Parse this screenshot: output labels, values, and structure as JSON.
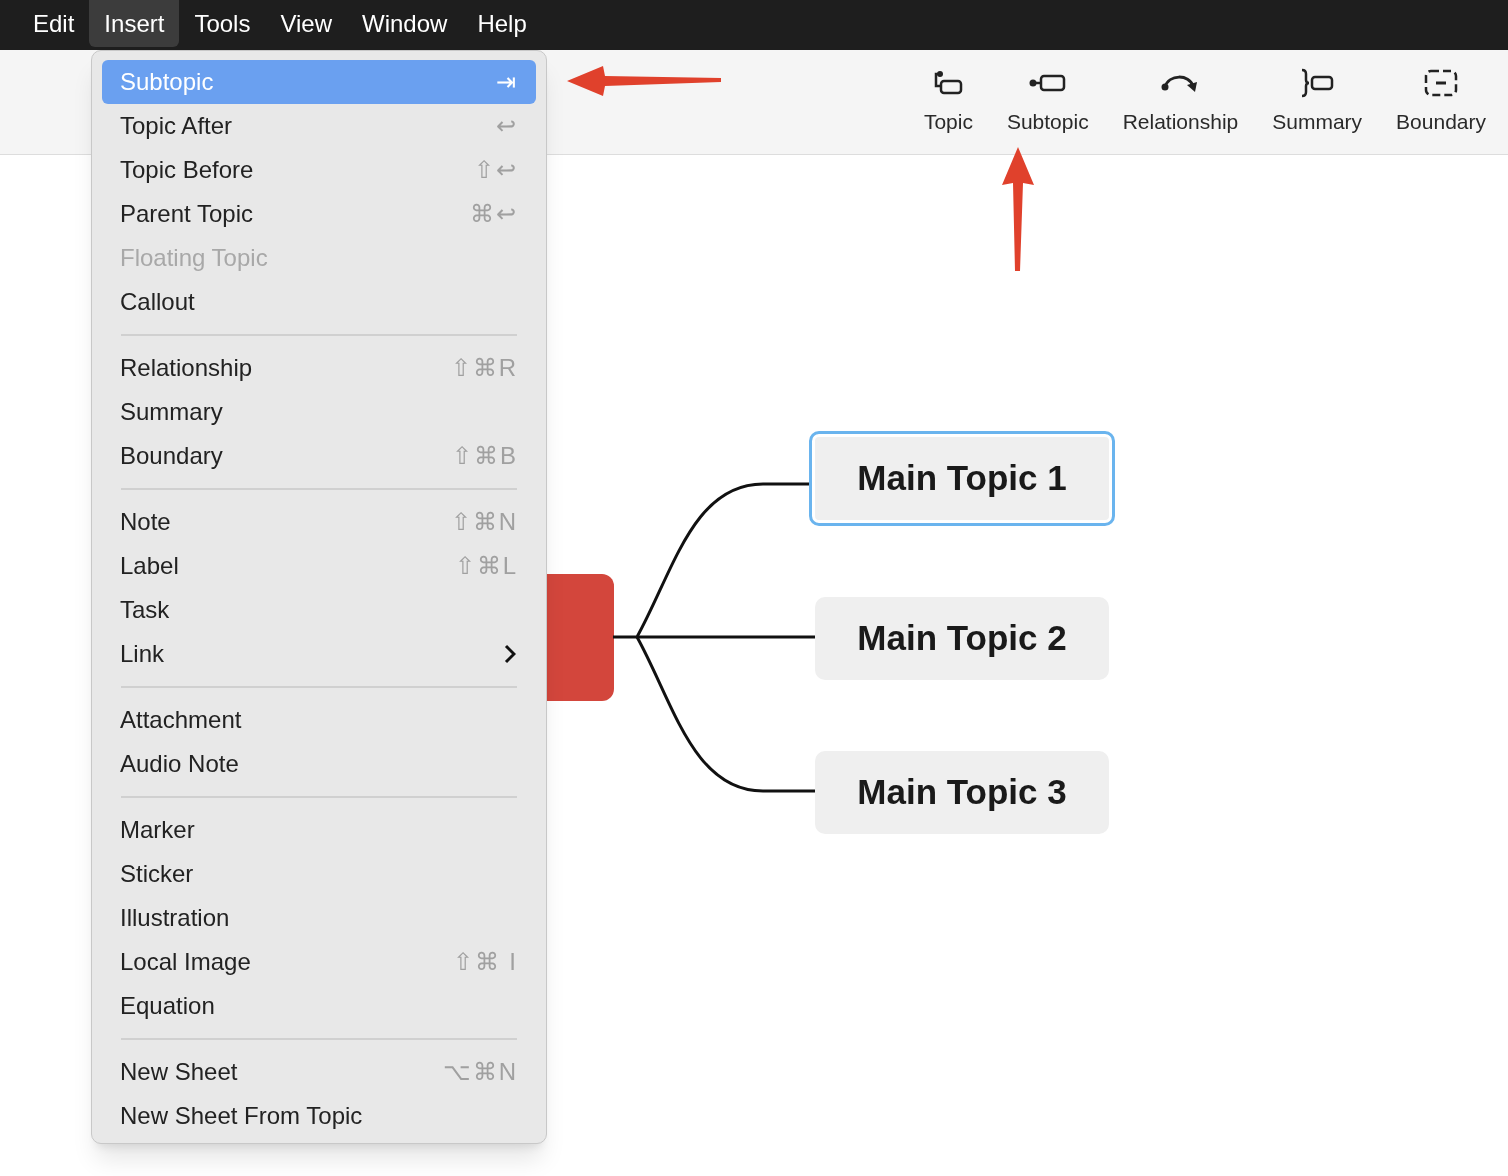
{
  "menu_bar": {
    "items": [
      {
        "label": "Edit",
        "selected": false
      },
      {
        "label": "Insert",
        "selected": true
      },
      {
        "label": "Tools",
        "selected": false
      },
      {
        "label": "View",
        "selected": false
      },
      {
        "label": "Window",
        "selected": false
      },
      {
        "label": "Help",
        "selected": false
      }
    ]
  },
  "toolbar": {
    "buttons": [
      {
        "label": "Topic",
        "kind": "topic"
      },
      {
        "label": "Subtopic",
        "kind": "subtopic"
      },
      {
        "label": "Relationship",
        "kind": "relationship"
      },
      {
        "label": "Summary",
        "kind": "summary"
      },
      {
        "label": "Boundary",
        "kind": "boundary"
      }
    ]
  },
  "insert_menu": {
    "groups": [
      {
        "items": [
          {
            "label": "Subtopic",
            "shortcut": "⇥",
            "selected": true,
            "disabled": false,
            "kind": "command"
          },
          {
            "label": "Topic After",
            "shortcut": "↩",
            "selected": false,
            "disabled": false,
            "kind": "command"
          },
          {
            "label": "Topic Before",
            "shortcut": "⇧↩",
            "selected": false,
            "disabled": false,
            "kind": "command"
          },
          {
            "label": "Parent Topic",
            "shortcut": "⌘↩",
            "selected": false,
            "disabled": false,
            "kind": "command"
          },
          {
            "label": "Floating Topic",
            "selected": false,
            "disabled": true,
            "kind": "command"
          },
          {
            "label": "Callout",
            "selected": false,
            "disabled": false,
            "kind": "command"
          }
        ]
      },
      {
        "items": [
          {
            "label": "Relationship",
            "shortcut": "⇧⌘R",
            "selected": false,
            "disabled": false,
            "kind": "command"
          },
          {
            "label": "Summary",
            "selected": false,
            "disabled": false,
            "kind": "command"
          },
          {
            "label": "Boundary",
            "shortcut": "⇧⌘B",
            "selected": false,
            "disabled": false,
            "kind": "command"
          }
        ]
      },
      {
        "items": [
          {
            "label": "Note",
            "shortcut": "⇧⌘N",
            "selected": false,
            "disabled": false,
            "kind": "command"
          },
          {
            "label": "Label",
            "shortcut": "⇧⌘L",
            "selected": false,
            "disabled": false,
            "kind": "command"
          },
          {
            "label": "Task",
            "selected": false,
            "disabled": false,
            "kind": "command"
          },
          {
            "label": "Link",
            "selected": false,
            "disabled": false,
            "kind": "submenu"
          }
        ]
      },
      {
        "items": [
          {
            "label": "Attachment",
            "selected": false,
            "disabled": false,
            "kind": "command"
          },
          {
            "label": "Audio Note",
            "selected": false,
            "disabled": false,
            "kind": "command"
          }
        ]
      },
      {
        "items": [
          {
            "label": "Marker",
            "selected": false,
            "disabled": false,
            "kind": "command"
          },
          {
            "label": "Sticker",
            "selected": false,
            "disabled": false,
            "kind": "command"
          },
          {
            "label": "Illustration",
            "selected": false,
            "disabled": false,
            "kind": "command"
          },
          {
            "label": "Local Image",
            "shortcut": "⇧⌘ I",
            "selected": false,
            "disabled": false,
            "kind": "command"
          },
          {
            "label": "Equation",
            "selected": false,
            "disabled": false,
            "kind": "command"
          }
        ]
      },
      {
        "items": [
          {
            "label": "New Sheet",
            "shortcut": "⌥⌘N",
            "selected": false,
            "disabled": false,
            "kind": "command"
          },
          {
            "label": "New Sheet From Topic",
            "selected": false,
            "disabled": false,
            "kind": "command"
          }
        ]
      }
    ]
  },
  "mind_map": {
    "main_topics": [
      {
        "label": "Main Topic 1",
        "selected": true
      },
      {
        "label": "Main Topic 2",
        "selected": false
      },
      {
        "label": "Main Topic 3",
        "selected": false
      }
    ]
  }
}
